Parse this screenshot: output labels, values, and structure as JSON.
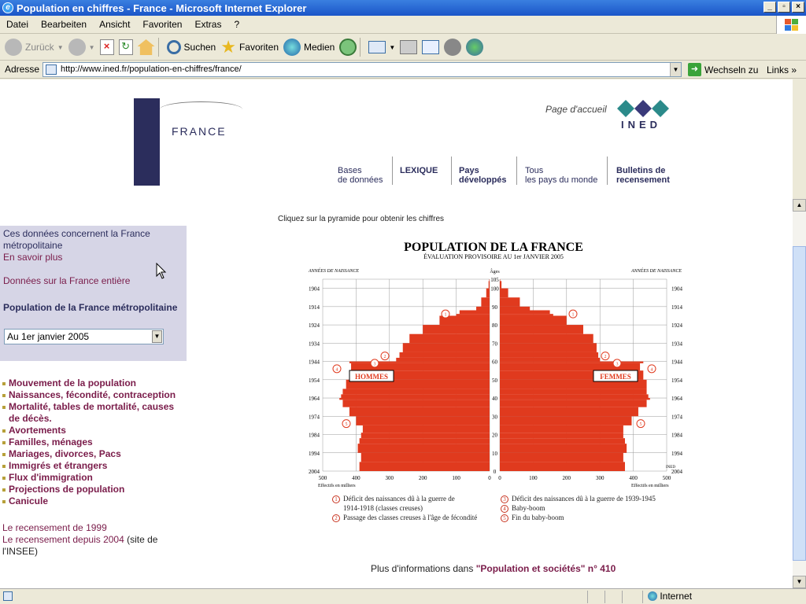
{
  "window": {
    "title": "Population en chiffres - France - Microsoft Internet Explorer"
  },
  "menu": [
    "Datei",
    "Bearbeiten",
    "Ansicht",
    "Favoriten",
    "Extras",
    "?"
  ],
  "toolbar": {
    "back": "Zurück",
    "search": "Suchen",
    "favorites": "Favoriten",
    "media": "Medien"
  },
  "address": {
    "label": "Adresse",
    "url": "http://www.ined.fr/population-en-chiffres/france/",
    "go": "Wechseln zu",
    "links": "Links"
  },
  "header": {
    "site_name": "FRANCE",
    "home": "Page d'accueil",
    "logo_text": "INED"
  },
  "topnav": [
    {
      "l1": "Bases",
      "l2": "de données"
    },
    {
      "l1": "",
      "l2": "LEXIQUE"
    },
    {
      "l1": "Pays",
      "l2": "développés"
    },
    {
      "l1": "Tous",
      "l2": "les pays du monde"
    },
    {
      "l1": "Bulletins de",
      "l2": "recensement"
    }
  ],
  "hint": "Cliquez sur la pyramide pour obtenir les chiffres",
  "sidebar": {
    "info1": "Ces données concernent la France",
    "info2": "métropolitaine",
    "more": "En savoir plus",
    "whole": "Données sur la France entière",
    "heading": "Population de la France métropolitaine",
    "select": "Au 1er janvier 2005"
  },
  "menu_items": [
    "Mouvement de la population",
    "Naissances, fécondité, contraception",
    "Mortalité, tables de mortalité, causes de décès.",
    "Avortements",
    "Familles, ménages",
    "Mariages, divorces, Pacs",
    "Immigrés et étrangers",
    "Flux d'immigration",
    "Projections de population",
    "Canicule"
  ],
  "bottom": {
    "census1999": "Le recensement de 1999",
    "census2004": "Le recensement depuis 2004",
    "insee": " (site de l'INSEE)"
  },
  "chart_data": {
    "type": "bar",
    "title": "POPULATION DE LA FRANCE",
    "subtitle": "ÉVALUATION PROVISOIRE AU 1er JANVIER 2005",
    "left_axis_title": "ANNÉES DE NAISSANCE",
    "center_axis_title": "Âges",
    "right_axis_title": "ANNÉES DE NAISSANCE",
    "xlabel": "Effectifs en milliers",
    "male_label": "HOMMES",
    "female_label": "FEMMES",
    "credit": "INED",
    "birth_years": [
      "1904",
      "1914",
      "1924",
      "1934",
      "1944",
      "1954",
      "1964",
      "1974",
      "1984",
      "1994",
      "2004"
    ],
    "age_ticks": [
      "105",
      "100",
      "90",
      "80",
      "70",
      "60",
      "50",
      "40",
      "30",
      "20",
      "10",
      "0"
    ],
    "x_ticks": [
      "500",
      "400",
      "300",
      "200",
      "100",
      "0"
    ],
    "xlim": [
      0,
      500
    ],
    "age_points": [
      0,
      5,
      10,
      15,
      18,
      21,
      25,
      30,
      35,
      39,
      40,
      42,
      45,
      50,
      55,
      59,
      60,
      62,
      65,
      70,
      75,
      80,
      85,
      86,
      88,
      90,
      95,
      100,
      104
    ],
    "males": [
      390,
      385,
      395,
      390,
      385,
      380,
      400,
      420,
      440,
      450,
      445,
      440,
      430,
      420,
      415,
      420,
      280,
      270,
      260,
      240,
      200,
      150,
      100,
      90,
      40,
      25,
      10,
      3,
      1
    ],
    "females": [
      375,
      370,
      380,
      375,
      370,
      370,
      395,
      415,
      440,
      450,
      445,
      440,
      440,
      430,
      420,
      430,
      300,
      295,
      290,
      280,
      250,
      200,
      160,
      150,
      90,
      60,
      25,
      5,
      1
    ],
    "annotations": {
      "male": {
        "1": 86,
        "2": 63,
        "3": 59,
        "4": 56,
        "5": 26
      },
      "female": {
        "1": 86,
        "2": 63,
        "3": 59,
        "4": 56,
        "5": 26
      }
    },
    "legend": [
      {
        "n": "1",
        "l1": "Déficit des naissances dû à la guerre de",
        "l2": "1914-1918 (classes creuses)"
      },
      {
        "n": "2",
        "l1": "Passage des classes creuses à l'âge de fécondité",
        "l2": ""
      },
      {
        "n": "3",
        "l1": "Déficit des naissances dû à la guerre de 1939-1945",
        "l2": ""
      },
      {
        "n": "4",
        "l1": "Baby-boom",
        "l2": ""
      },
      {
        "n": "5",
        "l1": "Fin du baby-boom",
        "l2": ""
      }
    ],
    "colors": {
      "bars": "#e03a1e",
      "grid": "#999999"
    }
  },
  "more": {
    "prefix": "Plus d'informations dans ",
    "link": "\"Population et sociétés\" n° 410"
  },
  "status": {
    "zone": "Internet"
  }
}
